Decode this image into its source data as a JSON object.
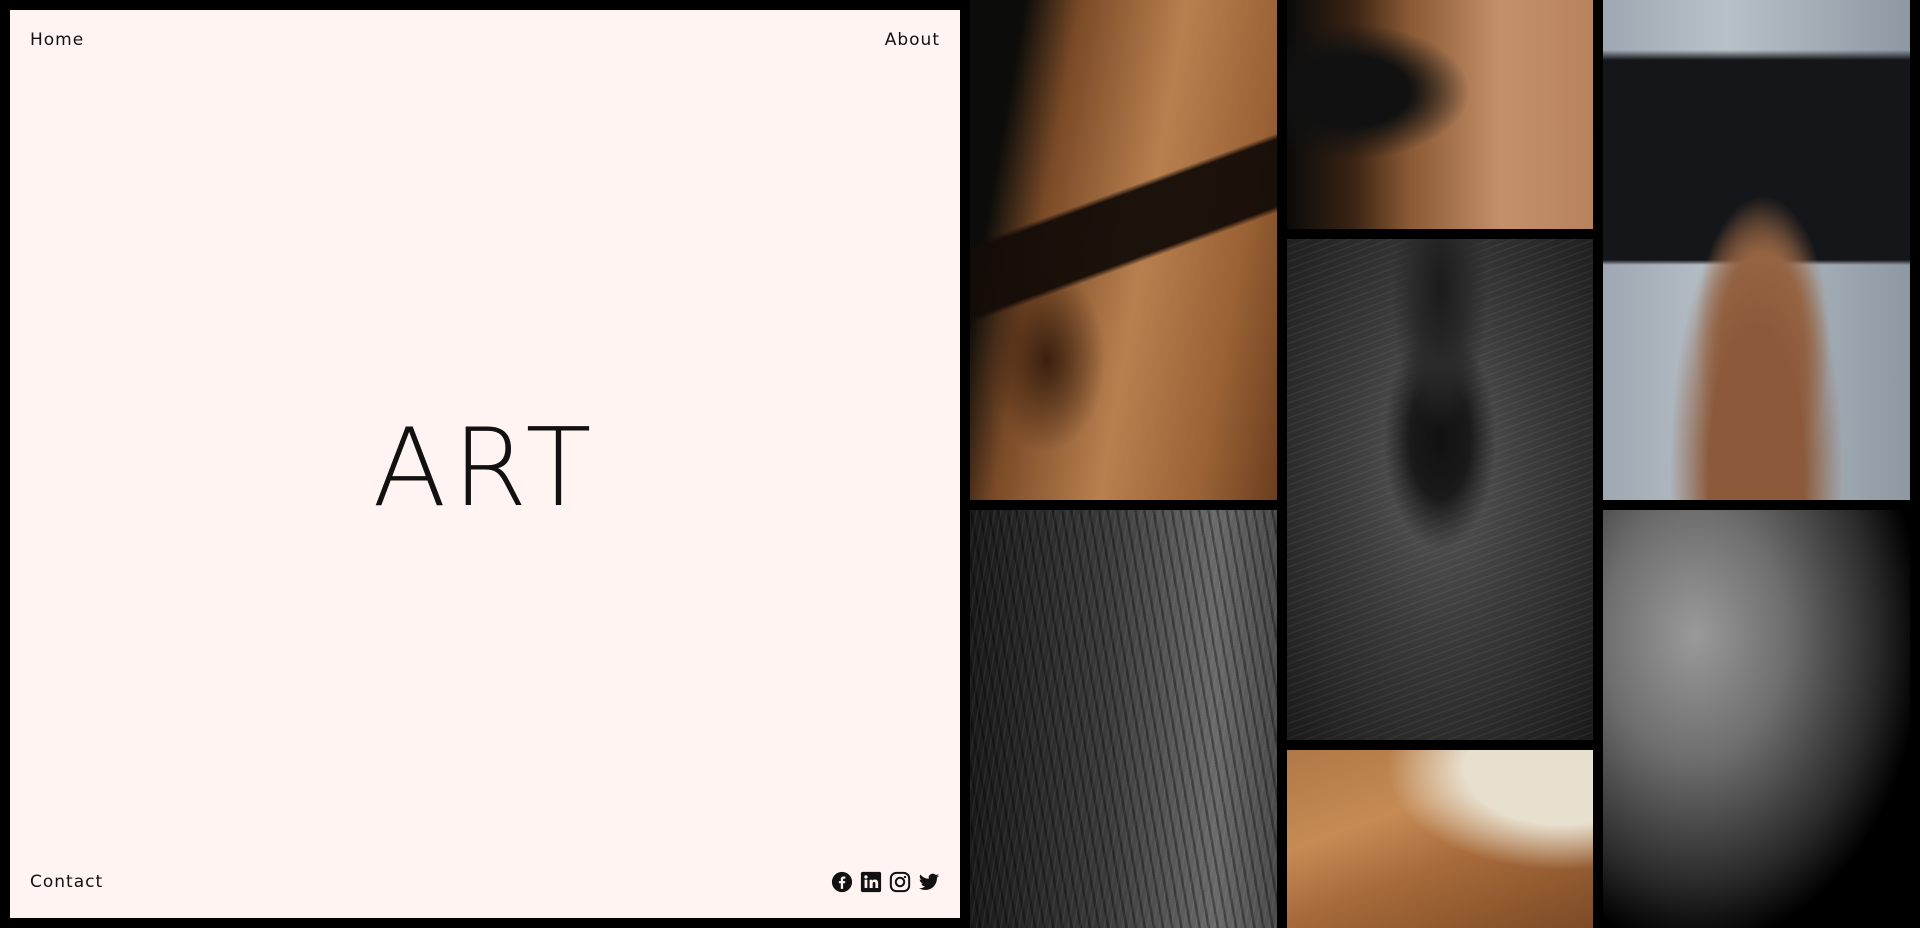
{
  "nav": {
    "home": "Home",
    "about": "About",
    "contact": "Contact"
  },
  "hero": {
    "title": "ART"
  },
  "social": [
    "facebook-icon",
    "linkedin-icon",
    "instagram-icon",
    "twitter-icon"
  ],
  "colors": {
    "panel_bg": "#fff4f1",
    "frame": "#000000",
    "text": "#111111"
  }
}
